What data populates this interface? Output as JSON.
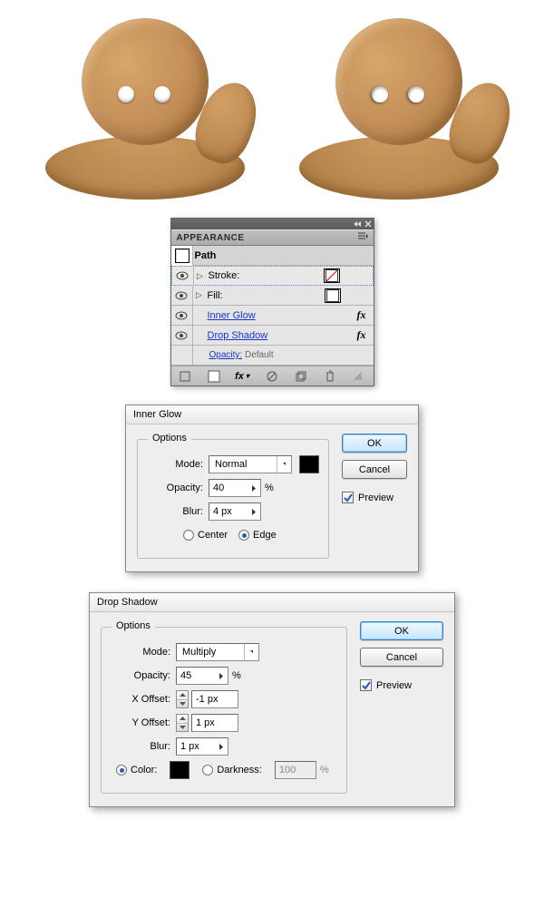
{
  "appearance": {
    "title": "APPEARANCE",
    "path_label": "Path",
    "stroke_label": "Stroke:",
    "fill_label": "Fill:",
    "inner_glow": "Inner Glow",
    "drop_shadow": "Drop Shadow",
    "opacity_label": "Opacity:",
    "opacity_value": "Default",
    "fx": "fx"
  },
  "inner_glow_dialog": {
    "title": "Inner Glow",
    "options_legend": "Options",
    "mode_label": "Mode:",
    "mode_value": "Normal",
    "opacity_label": "Opacity:",
    "opacity_value": "40",
    "opacity_unit": "%",
    "blur_label": "Blur:",
    "blur_value": "4 px",
    "center_label": "Center",
    "edge_label": "Edge",
    "ok": "OK",
    "cancel": "Cancel",
    "preview": "Preview"
  },
  "drop_shadow_dialog": {
    "title": "Drop Shadow",
    "options_legend": "Options",
    "mode_label": "Mode:",
    "mode_value": "Multiply",
    "opacity_label": "Opacity:",
    "opacity_value": "45",
    "opacity_unit": "%",
    "xoffset_label": "X Offset:",
    "xoffset_value": "-1 px",
    "yoffset_label": "Y Offset:",
    "yoffset_value": "1 px",
    "blur_label": "Blur:",
    "blur_value": "1 px",
    "color_label": "Color:",
    "darkness_label": "Darkness:",
    "darkness_value": "100",
    "darkness_unit": "%",
    "ok": "OK",
    "cancel": "Cancel",
    "preview": "Preview"
  }
}
